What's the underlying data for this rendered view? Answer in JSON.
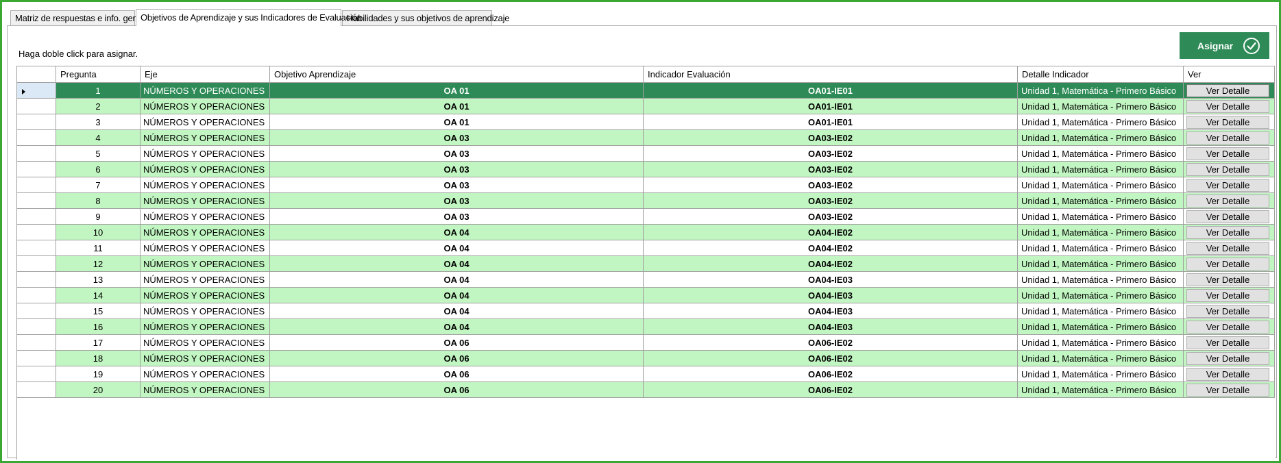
{
  "tabs": [
    {
      "label": "Matriz de respuestas e info. general"
    },
    {
      "label": "Objetivos de Aprendizaje y sus Indicadores de Evaluación"
    },
    {
      "label": "Habilidades y sus objetivos de aprendizaje"
    }
  ],
  "active_tab": 1,
  "hint": "Haga doble click para asignar.",
  "assign_button": {
    "label": "Asignar",
    "icon": "check-circle-icon"
  },
  "colors": {
    "accent": "#2e8b57",
    "alt_row": "#c1f5c1",
    "frame": "#3aa832"
  },
  "grid": {
    "columns": [
      "Pregunta",
      "Eje",
      "Objetivo Aprendizaje",
      "Indicador Evaluación",
      "Detalle Indicador",
      "Ver"
    ],
    "selected_row": 0,
    "rows": [
      {
        "pregunta": "1",
        "eje": "NÚMEROS Y OPERACIONES",
        "oa": "OA 01",
        "indicador": "OA01-IE01",
        "detalle": "Unidad 1, Matemática - Primero Básico",
        "ver": "Ver Detalle"
      },
      {
        "pregunta": "2",
        "eje": "NÚMEROS Y OPERACIONES",
        "oa": "OA 01",
        "indicador": "OA01-IE01",
        "detalle": "Unidad 1, Matemática - Primero Básico",
        "ver": "Ver Detalle"
      },
      {
        "pregunta": "3",
        "eje": "NÚMEROS Y OPERACIONES",
        "oa": "OA 01",
        "indicador": "OA01-IE01",
        "detalle": "Unidad 1, Matemática - Primero Básico",
        "ver": "Ver Detalle"
      },
      {
        "pregunta": "4",
        "eje": "NÚMEROS Y OPERACIONES",
        "oa": "OA 03",
        "indicador": "OA03-IE02",
        "detalle": "Unidad 1, Matemática - Primero Básico",
        "ver": "Ver Detalle"
      },
      {
        "pregunta": "5",
        "eje": "NÚMEROS Y OPERACIONES",
        "oa": "OA 03",
        "indicador": "OA03-IE02",
        "detalle": "Unidad 1, Matemática - Primero Básico",
        "ver": "Ver Detalle"
      },
      {
        "pregunta": "6",
        "eje": "NÚMEROS Y OPERACIONES",
        "oa": "OA 03",
        "indicador": "OA03-IE02",
        "detalle": "Unidad 1, Matemática - Primero Básico",
        "ver": "Ver Detalle"
      },
      {
        "pregunta": "7",
        "eje": "NÚMEROS Y OPERACIONES",
        "oa": "OA 03",
        "indicador": "OA03-IE02",
        "detalle": "Unidad 1, Matemática - Primero Básico",
        "ver": "Ver Detalle"
      },
      {
        "pregunta": "8",
        "eje": "NÚMEROS Y OPERACIONES",
        "oa": "OA 03",
        "indicador": "OA03-IE02",
        "detalle": "Unidad 1, Matemática - Primero Básico",
        "ver": "Ver Detalle"
      },
      {
        "pregunta": "9",
        "eje": "NÚMEROS Y OPERACIONES",
        "oa": "OA 03",
        "indicador": "OA03-IE02",
        "detalle": "Unidad 1, Matemática - Primero Básico",
        "ver": "Ver Detalle"
      },
      {
        "pregunta": "10",
        "eje": "NÚMEROS Y OPERACIONES",
        "oa": "OA 04",
        "indicador": "OA04-IE02",
        "detalle": "Unidad 1, Matemática - Primero Básico",
        "ver": "Ver Detalle"
      },
      {
        "pregunta": "11",
        "eje": "NÚMEROS Y OPERACIONES",
        "oa": "OA 04",
        "indicador": "OA04-IE02",
        "detalle": "Unidad 1, Matemática - Primero Básico",
        "ver": "Ver Detalle"
      },
      {
        "pregunta": "12",
        "eje": "NÚMEROS Y OPERACIONES",
        "oa": "OA 04",
        "indicador": "OA04-IE02",
        "detalle": "Unidad 1, Matemática - Primero Básico",
        "ver": "Ver Detalle"
      },
      {
        "pregunta": "13",
        "eje": "NÚMEROS Y OPERACIONES",
        "oa": "OA 04",
        "indicador": "OA04-IE03",
        "detalle": "Unidad 1, Matemática - Primero Básico",
        "ver": "Ver Detalle"
      },
      {
        "pregunta": "14",
        "eje": "NÚMEROS Y OPERACIONES",
        "oa": "OA 04",
        "indicador": "OA04-IE03",
        "detalle": "Unidad 1, Matemática - Primero Básico",
        "ver": "Ver Detalle"
      },
      {
        "pregunta": "15",
        "eje": "NÚMEROS Y OPERACIONES",
        "oa": "OA 04",
        "indicador": "OA04-IE03",
        "detalle": "Unidad 1, Matemática - Primero Básico",
        "ver": "Ver Detalle"
      },
      {
        "pregunta": "16",
        "eje": "NÚMEROS Y OPERACIONES",
        "oa": "OA 04",
        "indicador": "OA04-IE03",
        "detalle": "Unidad 1, Matemática - Primero Básico",
        "ver": "Ver Detalle"
      },
      {
        "pregunta": "17",
        "eje": "NÚMEROS Y OPERACIONES",
        "oa": "OA 06",
        "indicador": "OA06-IE02",
        "detalle": "Unidad 1, Matemática - Primero Básico",
        "ver": "Ver Detalle"
      },
      {
        "pregunta": "18",
        "eje": "NÚMEROS Y OPERACIONES",
        "oa": "OA 06",
        "indicador": "OA06-IE02",
        "detalle": "Unidad 1, Matemática - Primero Básico",
        "ver": "Ver Detalle"
      },
      {
        "pregunta": "19",
        "eje": "NÚMEROS Y OPERACIONES",
        "oa": "OA 06",
        "indicador": "OA06-IE02",
        "detalle": "Unidad 1, Matemática - Primero Básico",
        "ver": "Ver Detalle"
      },
      {
        "pregunta": "20",
        "eje": "NÚMEROS Y OPERACIONES",
        "oa": "OA 06",
        "indicador": "OA06-IE02",
        "detalle": "Unidad 1, Matemática - Primero Básico",
        "ver": "Ver Detalle"
      }
    ]
  }
}
